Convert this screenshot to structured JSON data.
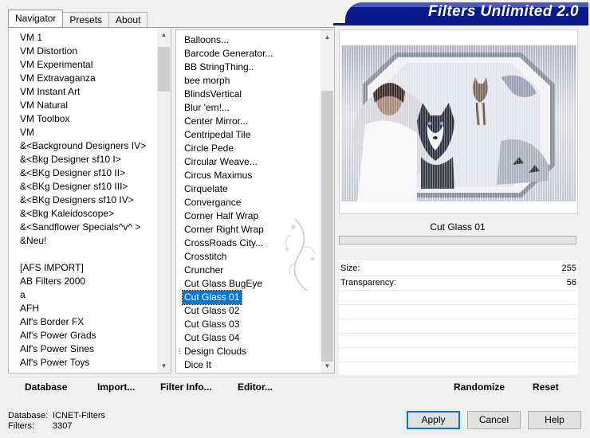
{
  "tabs": [
    {
      "label": "Navigator",
      "active": true
    },
    {
      "label": "Presets",
      "active": false
    },
    {
      "label": "About",
      "active": false
    }
  ],
  "banner": {
    "title": "Filters Unlimited 2.0",
    "color": "#0b1a8a"
  },
  "categories": [
    "VM 1",
    "VM Distortion",
    "VM Experimental",
    "VM Extravaganza",
    "VM Instant Art",
    "VM Natural",
    "VM Toolbox",
    "VM",
    "&<Background Designers IV>",
    "&<Bkg Designer sf10 I>",
    "&<BKg Designer sf10 II>",
    "&<BKg Designer sf10 III>",
    "&<BKg Designers sf10 IV>",
    "&<Bkg Kaleidoscope>",
    "&<Sandflower Specials^v^ >",
    "&Neu!",
    "",
    "[AFS IMPORT]",
    "AB Filters 2000",
    "a",
    "AFH",
    "Alf's Border FX",
    "Alf's Power Grads",
    "Alf's Power Sines",
    "Alf's Power Toys"
  ],
  "filters": [
    "Balloons...",
    "Barcode Generator...",
    "BB StringThing..",
    "bee morph",
    "BlindsVertical",
    "Blur 'em!...",
    "Center Mirror...",
    "Centripedal Tile",
    "Circle Pede",
    "Circular Weave...",
    "Circus Maximus",
    "Cirquelate",
    "Convergance",
    "Corner Half Wrap",
    "Corner Right Wrap",
    "CrossRoads City...",
    "Crosstitch",
    "Cruncher",
    "Cut Glass  BugEye",
    "Cut Glass 01",
    "Cut Glass 02",
    "Cut Glass 03",
    "Cut Glass 04",
    "Design Clouds",
    "Dice It"
  ],
  "selected_filter_index": 19,
  "preview": {
    "filter_name": "Cut Glass 01"
  },
  "params": [
    {
      "label": "Size:",
      "value": "255"
    },
    {
      "label": "Transparency:",
      "value": "56"
    }
  ],
  "toolbar": {
    "database": "Database",
    "import": "Import...",
    "filter_info": "Filter Info...",
    "editor": "Editor...",
    "randomize": "Randomize",
    "reset": "Reset"
  },
  "info": {
    "database_label": "Database:",
    "database_value": "ICNET-Filters",
    "filters_label": "Filters:",
    "filters_value": "3307"
  },
  "buttons": {
    "apply": "Apply",
    "cancel": "Cancel",
    "help": "Help"
  },
  "watermark_text": "Sylviane",
  "colors": {
    "selection": "#0078d7",
    "banner": "#0b1a8a"
  }
}
